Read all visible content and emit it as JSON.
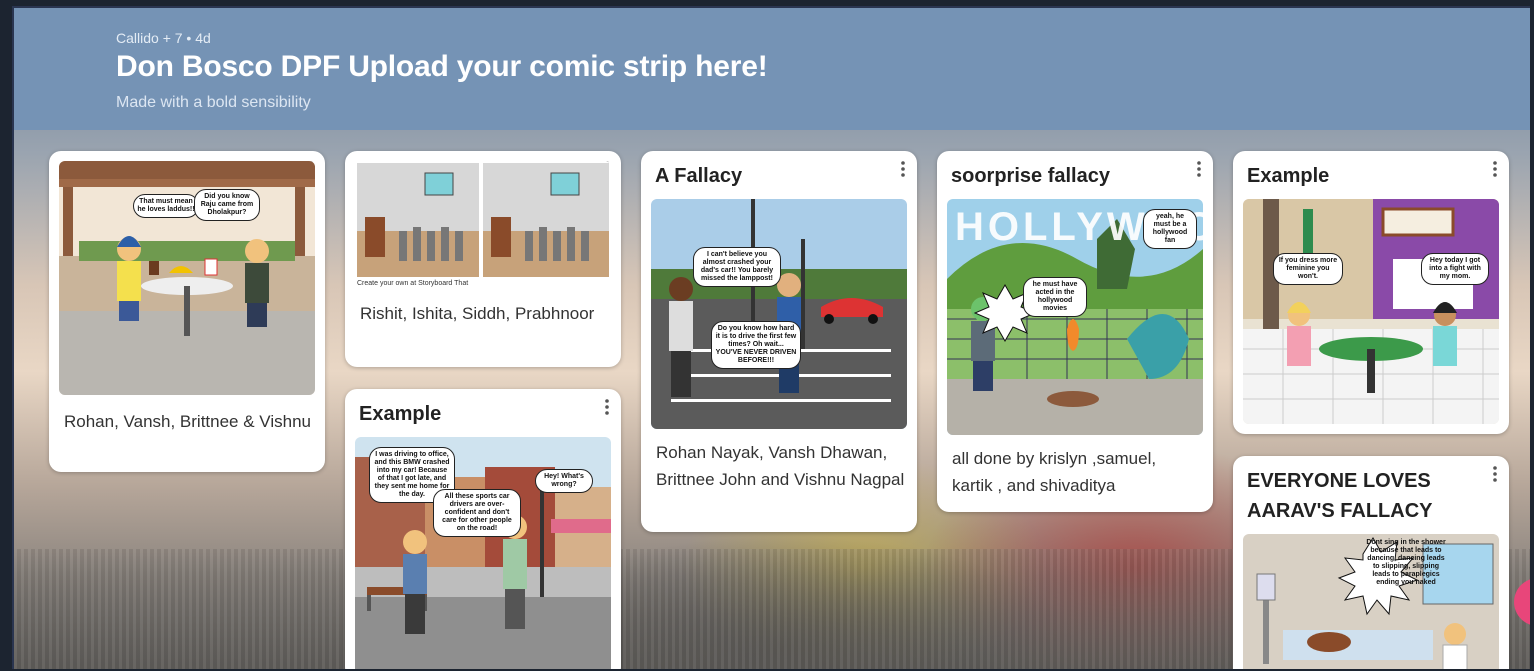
{
  "header": {
    "meta": "Callido + 7 • 4d",
    "title": "Don Bosco DPF Upload your comic strip here!",
    "subtitle": "Made with a bold sensibility"
  },
  "cards": [
    {
      "caption": "Rohan, Vansh, Brittnee & Vishnu",
      "bubbles": [
        "That must mean he loves laddus!!",
        "Did you know Raju came from Dholakpur?"
      ]
    },
    {
      "caption": "Rishit, Ishita, Siddh, Prabhnoor",
      "footer": "Create your own at Storyboard That"
    },
    {
      "title": "Example",
      "bubbles": [
        "I was driving to office, and this BMW crashed into my car! Because of that I got late, and they sent me home for the day.",
        "All these sports car drivers are over-confident and don't care for other people on the road!",
        "Hey! What's wrong?"
      ]
    },
    {
      "title": "A Fallacy",
      "caption": "Rohan Nayak, Vansh Dhawan, Brittnee John and Vishnu Nagpal",
      "bubbles": [
        "I can't believe you almost crashed your dad's car!! You barely missed the lamppost!",
        "Do you know how hard it is to drive the first few times? Oh wait... YOU'VE NEVER DRIVEN BEFORE!!!"
      ]
    },
    {
      "title": "soorprise fallacy",
      "caption": "all done by krislyn ,samuel, kartik , and shivaditya",
      "sign": "HOLLYWOO",
      "bubbles": [
        "yeah, he must be a hollywood fan",
        "he must have acted in the hollywood movies"
      ]
    },
    {
      "title": "Example",
      "bubbles": [
        "If you dress more feminine you won't.",
        "Hey today I got into a fight with my mom."
      ]
    },
    {
      "title": "EVERYONE LOVES AARAV'S FALLACY",
      "bubbles": [
        "Dont sing in the shower because that leads to dancing, dancing leads to slipping, slipping leads to paraplegics ending you naked"
      ]
    }
  ],
  "colors": {
    "header_bg": "#7593b5",
    "accent": "#e8467a"
  },
  "icons": {
    "card_menu": "more-vertical-icon"
  }
}
